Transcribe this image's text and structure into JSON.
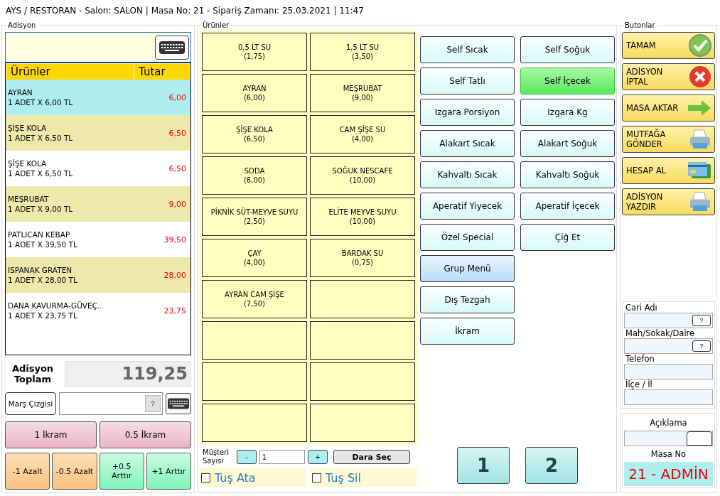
{
  "window": {
    "title": "AYS / RESTORAN - Salon: SALON | Masa No: 21 - Sipariş Zamanı: 25.03.2021 | 11:47"
  },
  "adisyon": {
    "label": "Adisyon",
    "columns": [
      "Ürünler",
      "Tutar"
    ],
    "rows": [
      {
        "name": "AYRAN",
        "detail": "1 ADET X 6,00 TL",
        "amount": "6,00",
        "selected": true
      },
      {
        "name": "ŞİŞE KOLA",
        "detail": "1 ADET X 6,50 TL",
        "amount": "6,50",
        "selected": false
      },
      {
        "name": "ŞİŞE KOLA",
        "detail": "1 ADET X 6,50 TL",
        "amount": "6,50",
        "selected": false
      },
      {
        "name": "MEŞRUBAT",
        "detail": "1 ADET X 9,00 TL",
        "amount": "9,00",
        "selected": false
      },
      {
        "name": "PATLICAN KEBAP",
        "detail": "1 ADET X 39,50 TL",
        "amount": "39,50",
        "selected": false
      },
      {
        "name": "ISPANAK GRATEN",
        "detail": "1 ADET X 28,00 TL",
        "amount": "28,00",
        "selected": false
      },
      {
        "name": "DANA KAVURMA-GÜVEÇ..",
        "detail": "1 ADET X 23,75 TL",
        "amount": "23,75",
        "selected": false
      }
    ],
    "total_label": "Adisyon Toplam",
    "total": "119,25",
    "mars_button": "Marş Çizgisi",
    "mars_help": "?",
    "ikram_buttons": [
      "1 İkram",
      "0.5 İkram"
    ],
    "qty_buttons": [
      {
        "label": "-1 Azalt",
        "kind": "decrease"
      },
      {
        "label": "-0.5 Azalt",
        "kind": "decrease"
      },
      {
        "label": "+0.5 Arttır",
        "kind": "increase"
      },
      {
        "label": "+1 Arttır",
        "kind": "increase"
      }
    ]
  },
  "urunler": {
    "label": "Ürünler",
    "products": [
      {
        "name": "0,5 LT SU",
        "price": "(1,75)"
      },
      {
        "name": "1,5 LT SU",
        "price": "(3,50)"
      },
      {
        "name": "AYRAN",
        "price": "(6,00)"
      },
      {
        "name": "MEŞRUBAT",
        "price": "(9,00)"
      },
      {
        "name": "ŞİŞE KOLA",
        "price": "(6,50)"
      },
      {
        "name": "CAM ŞİŞE SU",
        "price": "(4,00)"
      },
      {
        "name": "SODA",
        "price": "(6,00)"
      },
      {
        "name": "SOĞUK NESCAFE",
        "price": "(10,00)"
      },
      {
        "name": "PİKNİK SÜT-MEYVE SUYU",
        "price": "(2,50)"
      },
      {
        "name": "ELİTE MEYVE SUYU",
        "price": "(10,00)"
      },
      {
        "name": "ÇAY",
        "price": "(4,00)"
      },
      {
        "name": "BARDAK SU",
        "price": "(0,75)"
      },
      {
        "name": "AYRAN CAM ŞİŞE",
        "price": "(7,50)"
      }
    ],
    "categories_left": [
      {
        "label": "Self Sıcak",
        "selected": false,
        "focused": false
      },
      {
        "label": "Self Tatlı",
        "selected": false,
        "focused": false
      },
      {
        "label": "Izgara Porsiyon",
        "selected": false,
        "focused": false
      },
      {
        "label": "Alakart Sıcak",
        "selected": false,
        "focused": false
      },
      {
        "label": "Kahvaltı Sıcak",
        "selected": false,
        "focused": false
      },
      {
        "label": "Aperatif Yiyecek",
        "selected": false,
        "focused": false
      },
      {
        "label": "Özel Special",
        "selected": false,
        "focused": false
      },
      {
        "label": "Grup Menü",
        "selected": false,
        "focused": true
      },
      {
        "label": "Dış Tezgah",
        "selected": false,
        "focused": false
      },
      {
        "label": "İkram",
        "selected": false,
        "focused": false
      }
    ],
    "categories_right": [
      {
        "label": "Self Soğuk",
        "selected": false,
        "focused": false
      },
      {
        "label": "Self İçecek",
        "selected": true,
        "focused": false
      },
      {
        "label": "Izgara Kg",
        "selected": false,
        "focused": false
      },
      {
        "label": "Alakart Soğuk",
        "selected": false,
        "focused": false
      },
      {
        "label": "Kahvaltı Soğuk",
        "selected": false,
        "focused": false
      },
      {
        "label": "Aperatif İçecek",
        "selected": false,
        "focused": false
      },
      {
        "label": "Çiğ Et",
        "selected": false,
        "focused": false
      }
    ],
    "customer_count": {
      "label": "Müşteri Sayısı",
      "minus": "-",
      "value": "1",
      "plus": "+"
    },
    "dara_button": "Dara Seç",
    "key_options": [
      {
        "label": "Tuş Ata",
        "checked": false
      },
      {
        "label": "Tuş Sil",
        "checked": false
      }
    ],
    "pages": [
      "1",
      "2"
    ]
  },
  "butonlar": {
    "label": "Butonlar",
    "buttons": [
      {
        "label": "TAMAM",
        "kind": "check"
      },
      {
        "label": "ADİSYON İPTAL",
        "kind": "cancel"
      },
      {
        "label": "MASA AKTAR",
        "kind": "arrow"
      },
      {
        "label": "MUTFAĞA GÖNDER",
        "kind": "printer"
      },
      {
        "label": "HESAP AL",
        "kind": "card"
      },
      {
        "label": "ADİSYON YAZDIR",
        "kind": "printer"
      }
    ],
    "fields": [
      {
        "label": "Cari Adı",
        "help": "?"
      },
      {
        "label": "Mah/Sokak/Daire",
        "help": "?"
      },
      {
        "label": "Telefon"
      },
      {
        "label": "İlçe / İl"
      }
    ],
    "note_label": "Açıklama",
    "table_label": "Masa No",
    "table_value": "21 - ADMİN"
  }
}
